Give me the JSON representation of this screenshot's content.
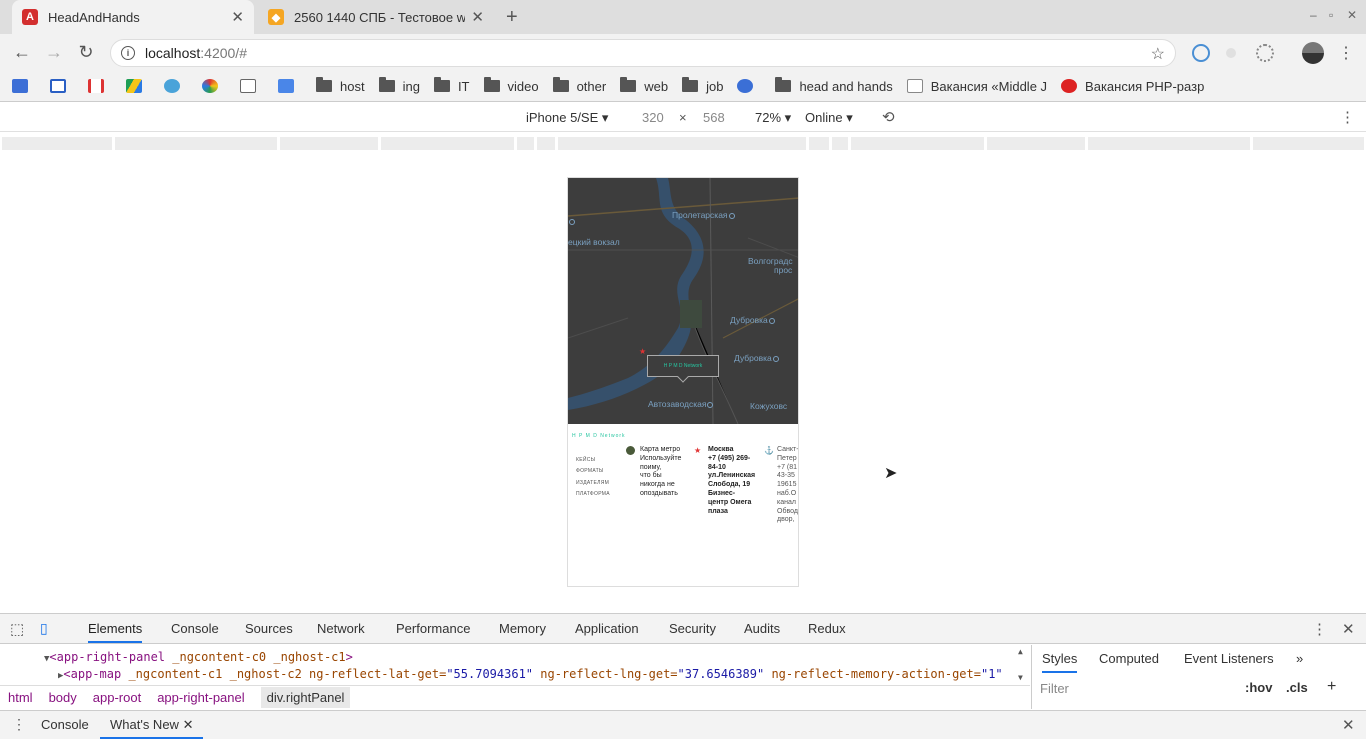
{
  "tabs": [
    {
      "title": "HeadAndHands",
      "favicon": "angular-icon",
      "active": true
    },
    {
      "title": "2560 1440 СПБ - Тестовое web",
      "favicon": "bird-icon",
      "active": false
    }
  ],
  "address": {
    "host": "localhost",
    "path": ":4200/#"
  },
  "bookmarks": [
    {
      "label": "",
      "icon": "youtube-icon"
    },
    {
      "label": "",
      "icon": "mail-icon"
    },
    {
      "label": "",
      "icon": "gmail-icon"
    },
    {
      "label": "",
      "icon": "drive-icon"
    },
    {
      "label": "",
      "icon": "globe-icon"
    },
    {
      "label": "",
      "icon": "star-icon"
    },
    {
      "label": "",
      "icon": "doc-icon"
    },
    {
      "label": "",
      "icon": "translate-icon"
    },
    {
      "label": "host",
      "icon": "folder-icon"
    },
    {
      "label": "ing",
      "icon": "folder-icon"
    },
    {
      "label": "IT",
      "icon": "folder-icon"
    },
    {
      "label": "video",
      "icon": "folder-icon"
    },
    {
      "label": "other",
      "icon": "folder-icon"
    },
    {
      "label": "web",
      "icon": "folder-icon"
    },
    {
      "label": "job",
      "icon": "folder-icon"
    },
    {
      "label": "",
      "icon": "gear-icon"
    },
    {
      "label": "head and hands",
      "icon": "folder-icon"
    },
    {
      "label": "Вакансия «Middle J",
      "icon": "page-icon"
    },
    {
      "label": "Вакансия PHP-разр",
      "icon": "hh-icon"
    }
  ],
  "device": {
    "name": "iPhone 5/SE",
    "width": "320",
    "x": "×",
    "height": "568",
    "zoom": "72%",
    "network": "Online"
  },
  "map": {
    "labels": [
      "Пролетарская",
      "ецкий вокзал",
      "Волгоградс",
      "прос",
      "Дубровка",
      "Дубровка",
      "Автозаводская",
      "Кожуховс"
    ],
    "popup": "H P M D  Network"
  },
  "panel": {
    "logo": "H P M D  Network",
    "nav": [
      "КЕЙСЫ",
      "ФОРМАТЫ",
      "ИЗДАТЕЛЯМ",
      "ПЛАТФОРМА"
    ],
    "metro": [
      "Карта метро",
      "Используйте",
      "поиму,",
      "что бы",
      "никогда не",
      "опоздывать"
    ],
    "moscow": [
      "Москва",
      "+7 (495) 269-",
      "84-10",
      "ул.Ленинская",
      "Слобода, 19",
      "Бизнес-",
      "центр Омега",
      "плаза"
    ],
    "spb": [
      "Санкт-",
      "Петер",
      "+7 (81",
      "43-35",
      "19615",
      "наб.О",
      "канал",
      "Обвод",
      "двор,"
    ]
  },
  "devtools": {
    "tabs": [
      "Elements",
      "Console",
      "Sources",
      "Network",
      "Performance",
      "Memory",
      "Application",
      "Security",
      "Audits",
      "Redux"
    ],
    "dom_line1": {
      "tag_open": "<app-right-panel",
      "attrs": " _ngcontent-c0 _nghost-c1",
      "tag_close": ">"
    },
    "dom_line2": {
      "tag": "<app-map",
      "a1": " _ngcontent-c1 _nghost-c2 ng-reflect-lat-get=",
      "v1": "\"55.7094361\"",
      "a2": " ng-reflect-lng-get=",
      "v2": "\"37.6546389\"",
      "a3": " ng-reflect-memory-action-get=",
      "v3": "\"1\""
    },
    "crumbs": [
      "html",
      "body",
      "app-root",
      "app-right-panel",
      "div.rightPanel"
    ],
    "styles_tabs": [
      "Styles",
      "Computed",
      "Event Listeners"
    ],
    "filter_placeholder": "Filter",
    "hov": ":hov",
    "cls": ".cls",
    "drawer_tabs": [
      "Console",
      "What's New"
    ]
  }
}
